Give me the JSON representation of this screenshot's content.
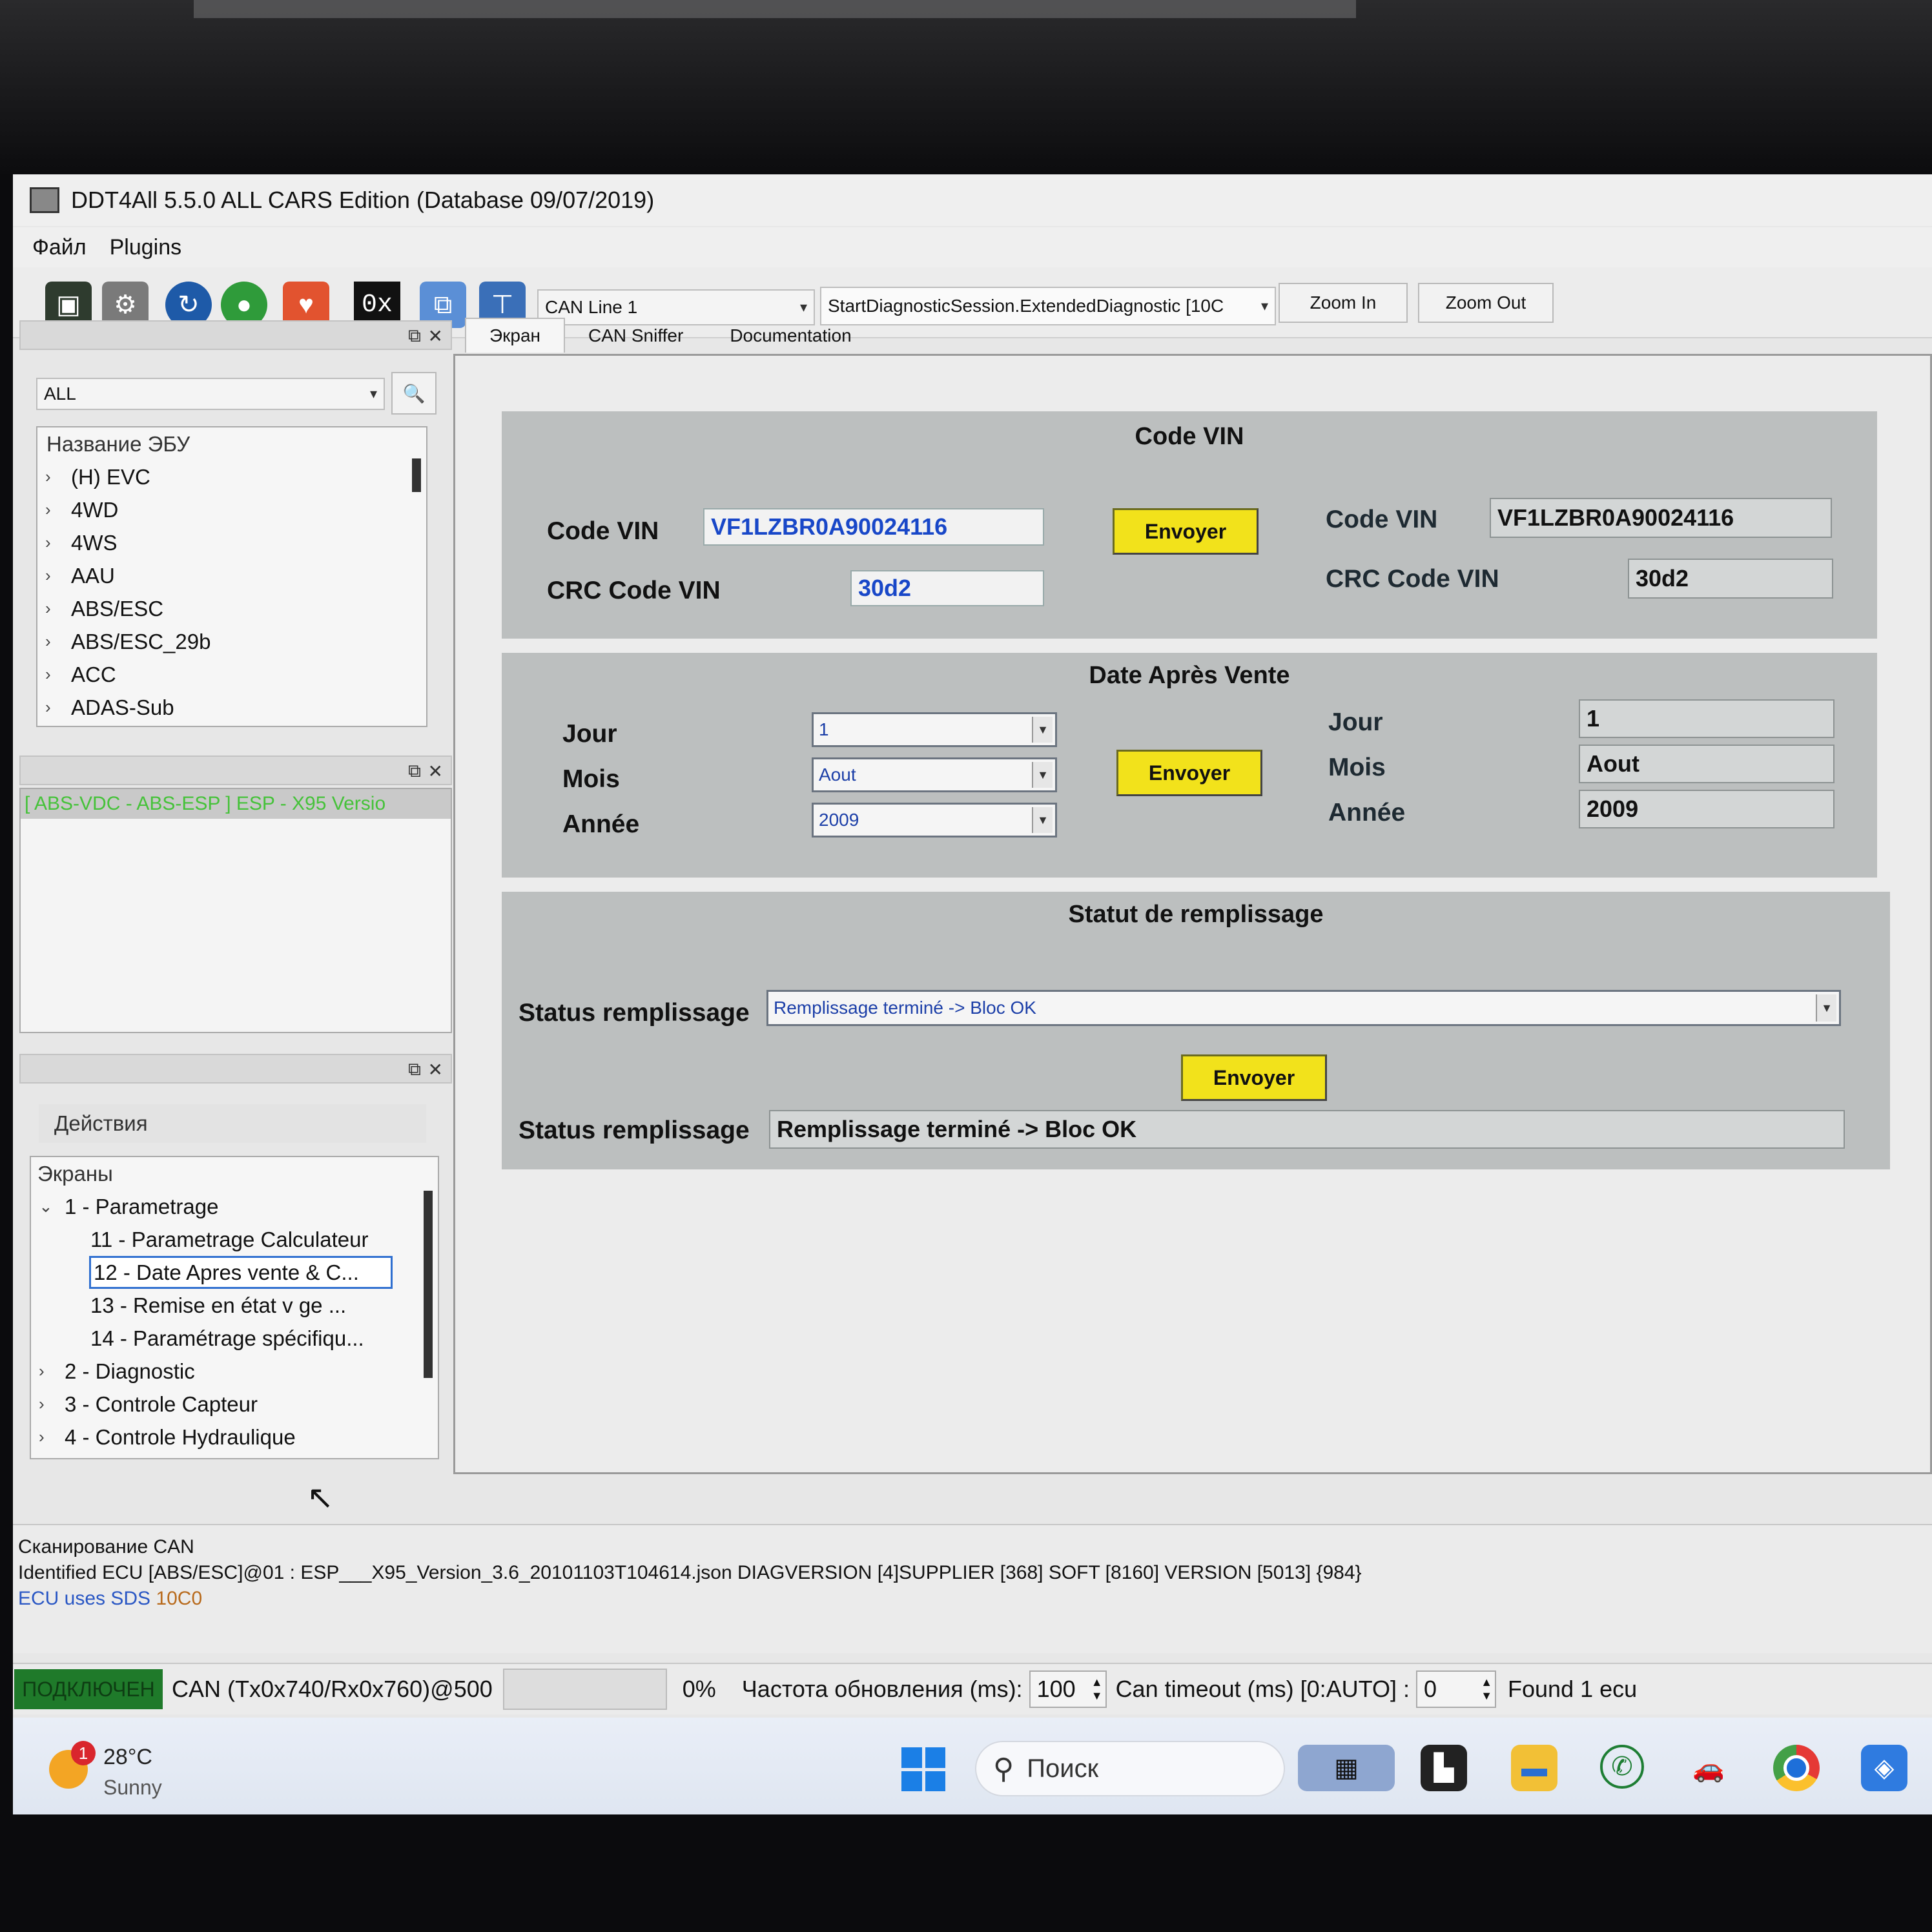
{
  "window": {
    "title": "DDT4All 5.5.0 ALL CARS Edition (Database 09/07/2019)"
  },
  "menu": {
    "items": [
      "Файл",
      "Plugins"
    ]
  },
  "toolbar": {
    "can_line": "CAN Line 1",
    "session": "StartDiagnosticSession.ExtendedDiagnostic [10C",
    "zoom_in": "Zoom In",
    "zoom_out": "Zoom Out",
    "hex_label": "0x"
  },
  "left": {
    "filter_value": "ALL",
    "ecu_header": "Название ЭБУ",
    "ecu_list": [
      "(H) EVC",
      "4WD",
      "4WS",
      "AAU",
      "ABS/ESC",
      "ABS/ESC_29b",
      "ACC",
      "ADAS-Sub"
    ],
    "selected_ecu": "[ ABS-VDC - ABS-ESP ] ESP - X95 Versio",
    "actions_label": "Действия",
    "screens_header": "Экраны",
    "screens": [
      {
        "label": "1 - Parametrage",
        "expanded": true
      },
      {
        "label": "11 - Parametrage Calculateur"
      },
      {
        "label": "12 - Date Apres vente & C...",
        "selected": true
      },
      {
        "label": "13 - Remise en état v   ge ..."
      },
      {
        "label": "14 - Paramétrage spécifiqu..."
      },
      {
        "label": "2 - Diagnostic"
      },
      {
        "label": "3 - Controle Capteur"
      },
      {
        "label": "4 - Controle Hydraulique"
      }
    ]
  },
  "tabs": [
    "Экран",
    "CAN Sniffer",
    "Documentation"
  ],
  "vin": {
    "title": "Code VIN",
    "code_label": "Code VIN",
    "code_value": "VF1LZBR0A90024116",
    "crc_label": "CRC Code VIN",
    "crc_value": "30d2",
    "send": "Envoyer",
    "read_code_label": "Code VIN",
    "read_code_value": "VF1LZBR0A90024116",
    "read_crc_label": "CRC Code VIN",
    "read_crc_value": "30d2"
  },
  "date": {
    "title": "Date Après Vente",
    "jour_label": "Jour",
    "mois_label": "Mois",
    "annee_label": "Année",
    "jour_value": "1",
    "mois_value": "Aout",
    "annee_value": "2009",
    "send": "Envoyer",
    "read_jour_label": "Jour",
    "read_mois_label": "Mois",
    "read_annee_label": "Année",
    "read_jour": "1",
    "read_mois": "Aout",
    "read_annee": "2009"
  },
  "fill": {
    "title": "Statut de remplissage",
    "label": "Status remplissage",
    "select_value": "Remplissage terminé -> Bloc OK",
    "send": "Envoyer",
    "read_label": "Status remplissage",
    "read_value": "Remplissage terminé -> Bloc OK"
  },
  "log": {
    "line1": "Сканирование CAN",
    "line2": "Identified ECU [ABS/ESC]@01 : ESP___X95_Version_3.6_20101103T104614.json DIAGVERSION [4]SUPPLIER [368] SOFT [8160] VERSION [5013] {984}",
    "line3_a": "ECU uses SDS",
    "line3_b": "10C0"
  },
  "status": {
    "connected": "ПОДКЛЮЧЕН",
    "can": "CAN (Tx0x740/Rx0x760)@500",
    "progress_text": "0%",
    "progress_fraction": 0,
    "refresh_label": "Частота обновления (ms):",
    "refresh_value": "100",
    "timeout_label": "Can timeout (ms) [0:AUTO] :",
    "timeout_value": "0",
    "found": "Found 1 ecu"
  },
  "taskbar": {
    "temp": "28°C",
    "weather": "Sunny",
    "badge": "1",
    "search_placeholder": "Поиск"
  },
  "colors": {
    "envoyer": "#f2e21b",
    "field_blue": "#1847c8",
    "connected_green": "#1f7a2a",
    "sds": "#b86a1c"
  }
}
